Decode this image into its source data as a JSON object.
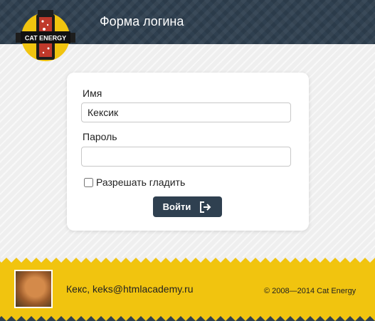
{
  "header": {
    "title": "Форма логина"
  },
  "logo": {
    "text": "CAT ENERGY"
  },
  "form": {
    "name_label": "Имя",
    "name_value": "Кексик",
    "password_label": "Пароль",
    "password_value": "",
    "allow_pet_label": "Разрешать гладить",
    "allow_pet_checked": false,
    "submit_label": "Войти"
  },
  "footer": {
    "contact": "Кекс, keks@htmlacademy.ru",
    "copyright": "© 2008—2014 Cat Energy"
  },
  "colors": {
    "header_bg": "#2f4050",
    "footer_bg": "#f1c40f",
    "button_bg": "#2f4050",
    "logo_red": "#c0392b"
  }
}
